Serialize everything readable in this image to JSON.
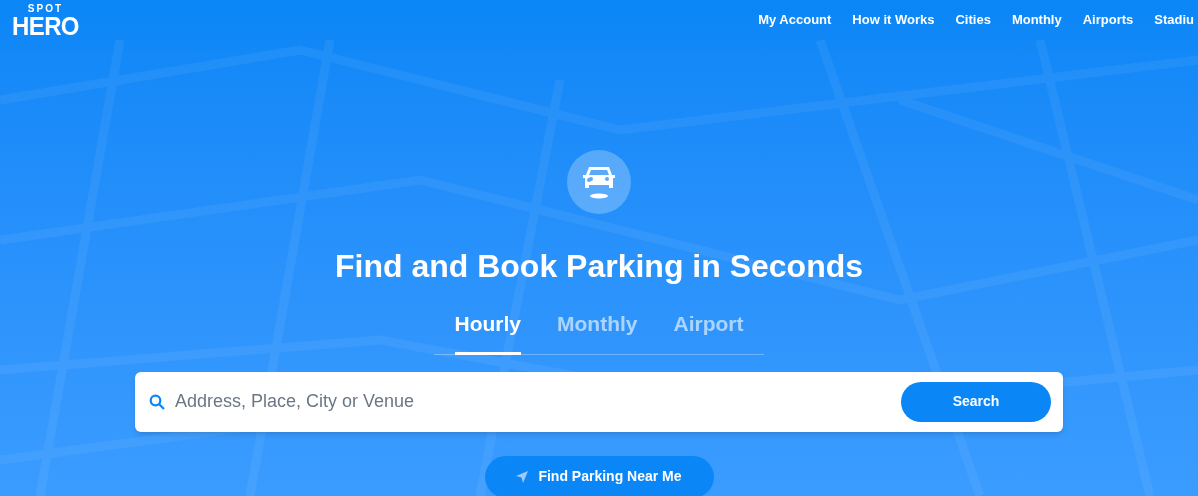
{
  "logo": {
    "line_1": "SPOT",
    "line_2": "HERO"
  },
  "nav": [
    "My Account",
    "How it Works",
    "Cities",
    "Monthly",
    "Airports",
    "Stadiu"
  ],
  "hero": {
    "title": "Find and Book Parking in Seconds"
  },
  "tabs": [
    {
      "label": "Hourly",
      "selected": true
    },
    {
      "label": "Monthly",
      "selected": false
    },
    {
      "label": "Airport",
      "selected": false
    }
  ],
  "search": {
    "placeholder": "Address, Place, City or Venue",
    "button": "Search"
  },
  "near_me_button": "Find Parking Near Me"
}
